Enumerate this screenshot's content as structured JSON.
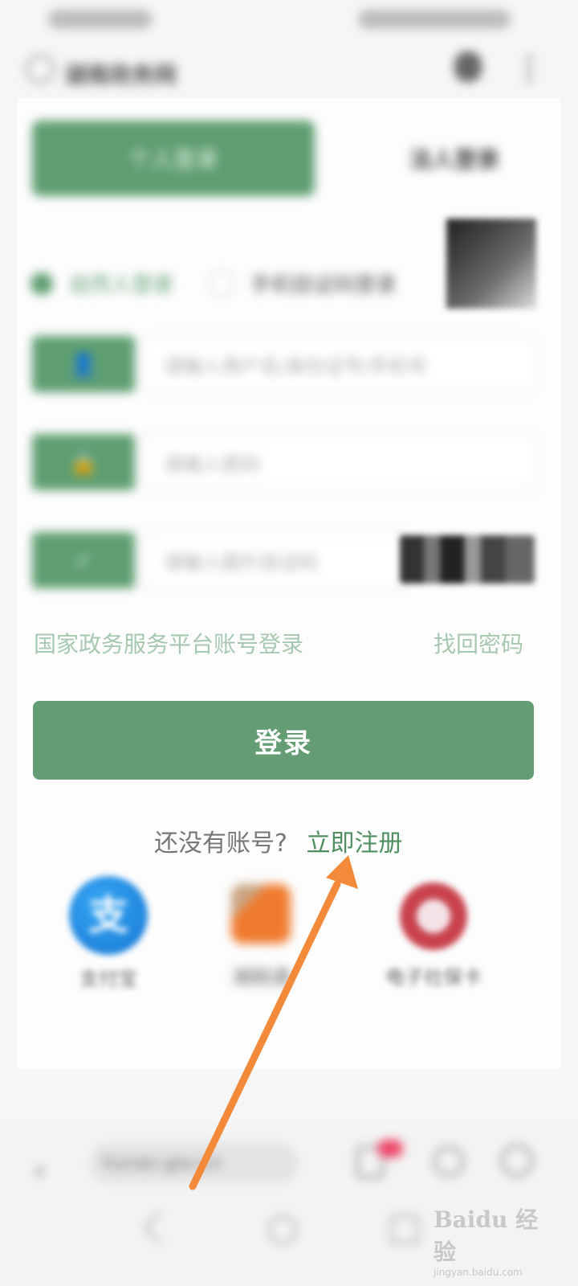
{
  "header": {
    "title": "湖南政务网"
  },
  "tabs": {
    "personal": "个人登录",
    "legal": "法人登录"
  },
  "login_types": {
    "option_user": "自然人登录",
    "option_other": "手机验证码登录"
  },
  "fields": {
    "username_placeholder": "请输入用户名/身份证号/手机号",
    "password_placeholder": "请输入密码",
    "captcha_placeholder": "请输入图片验证码"
  },
  "links": {
    "national": "国家政务服务平台账号登录",
    "forgot": "找回密码"
  },
  "login_button": "登录",
  "register": {
    "prompt": "还没有账号?",
    "link": "立即注册"
  },
  "third_party": [
    {
      "label": "支付宝",
      "glyph": "支"
    },
    {
      "label": "湘税通"
    },
    {
      "label": "电子社保卡"
    }
  ],
  "browser": {
    "address": "hunan.gov.cn"
  },
  "watermark": {
    "logo": "Baidu 经验",
    "sub": "jingyan.baidu.com"
  },
  "colors": {
    "accent": "#5f9e71",
    "button": "#649d74",
    "arrow": "#f28a3a"
  }
}
